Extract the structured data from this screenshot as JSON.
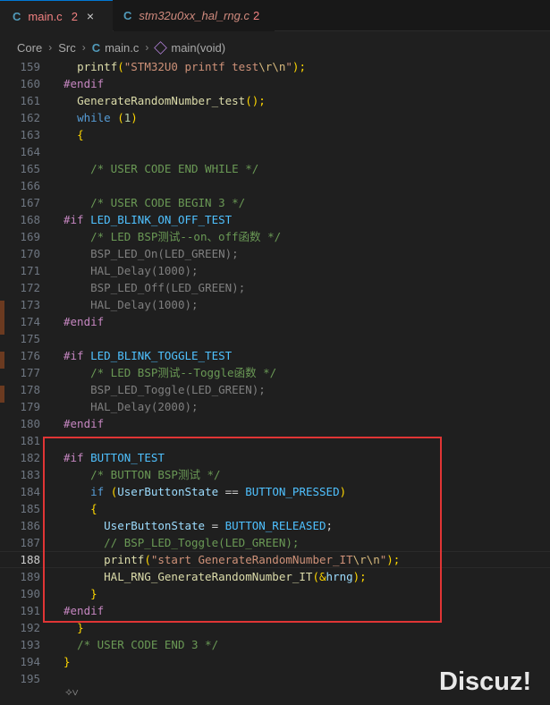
{
  "tabs": [
    {
      "icon": "C",
      "name": "main.c",
      "errors": "2",
      "close": "×"
    },
    {
      "icon": "C",
      "name": "stm32u0xx_hal_rng.c",
      "errors": "2"
    }
  ],
  "breadcrumb": {
    "items": [
      "Core",
      "Src",
      "main.c",
      "main(void)"
    ],
    "sep": "›"
  },
  "lines": [
    {
      "n": "159",
      "t": "  printf(\"STM32U0 printf test\\r\\n\");"
    },
    {
      "n": "160",
      "t": "#endif"
    },
    {
      "n": "161",
      "t": "  GenerateRandomNumber_test();"
    },
    {
      "n": "162",
      "t": "  while (1)"
    },
    {
      "n": "163",
      "t": "  {"
    },
    {
      "n": "164",
      "t": ""
    },
    {
      "n": "165",
      "t": "    /* USER CODE END WHILE */"
    },
    {
      "n": "166",
      "t": ""
    },
    {
      "n": "167",
      "t": "    /* USER CODE BEGIN 3 */"
    },
    {
      "n": "168",
      "t": "#if LED_BLINK_ON_OFF_TEST"
    },
    {
      "n": "169",
      "t": "    /* LED BSP测试--on、off函数 */"
    },
    {
      "n": "170",
      "t": "    BSP_LED_On(LED_GREEN);"
    },
    {
      "n": "171",
      "t": "    HAL_Delay(1000);"
    },
    {
      "n": "172",
      "t": "    BSP_LED_Off(LED_GREEN);"
    },
    {
      "n": "173",
      "t": "    HAL_Delay(1000);"
    },
    {
      "n": "174",
      "t": "#endif"
    },
    {
      "n": "175",
      "t": ""
    },
    {
      "n": "176",
      "t": "#if LED_BLINK_TOGGLE_TEST"
    },
    {
      "n": "177",
      "t": "    /* LED BSP测试--Toggle函数 */"
    },
    {
      "n": "178",
      "t": "    BSP_LED_Toggle(LED_GREEN);"
    },
    {
      "n": "179",
      "t": "    HAL_Delay(2000);"
    },
    {
      "n": "180",
      "t": "#endif"
    },
    {
      "n": "181",
      "t": ""
    },
    {
      "n": "182",
      "t": "#if BUTTON_TEST"
    },
    {
      "n": "183",
      "t": "    /* BUTTON BSP测试 */"
    },
    {
      "n": "184",
      "t": "    if (UserButtonState == BUTTON_PRESSED)"
    },
    {
      "n": "185",
      "t": "    {"
    },
    {
      "n": "186",
      "t": "      UserButtonState = BUTTON_RELEASED;"
    },
    {
      "n": "187",
      "t": "      // BSP_LED_Toggle(LED_GREEN);"
    },
    {
      "n": "188",
      "t": "      printf(\"start GenerateRandomNumber_IT\\r\\n\");"
    },
    {
      "n": "189",
      "t": "      HAL_RNG_GenerateRandomNumber_IT(&hrng);"
    },
    {
      "n": "190",
      "t": "    }"
    },
    {
      "n": "191",
      "t": "#endif"
    },
    {
      "n": "192",
      "t": "  }"
    },
    {
      "n": "193",
      "t": "  /* USER CODE END 3 */"
    },
    {
      "n": "194",
      "t": "}"
    },
    {
      "n": "195",
      "t": ""
    }
  ],
  "current_line": "188",
  "fold_icon": "⟡∨",
  "watermark": "Discuz!",
  "colors": {
    "accent": "#0078d4",
    "highlight_box": "#e03535",
    "keyword": "#569cd6",
    "preprocessor": "#c586c0",
    "function": "#dcdcaa",
    "string": "#ce9178",
    "comment": "#6a9955",
    "number": "#b5cea8",
    "macro": "#4fc1ff"
  }
}
